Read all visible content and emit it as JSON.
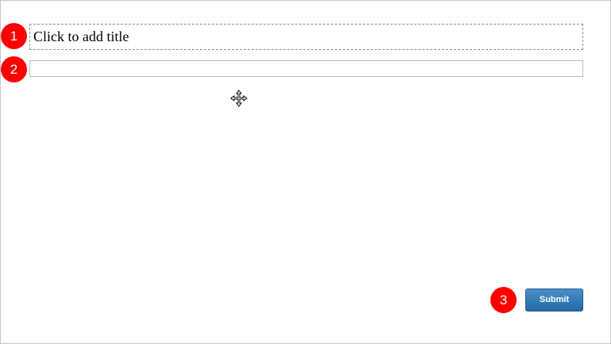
{
  "markers": [
    "1",
    "2",
    "3"
  ],
  "title_box": {
    "placeholder_text": "Click to add title"
  },
  "subtitle_input": {
    "value": "",
    "placeholder": ""
  },
  "cursor": {
    "icon": "move-cursor-icon"
  },
  "submit_button": {
    "label": "Submit",
    "color": "#2f78b5"
  },
  "colors": {
    "marker": "#ff0000",
    "button": "#2f78b5"
  }
}
